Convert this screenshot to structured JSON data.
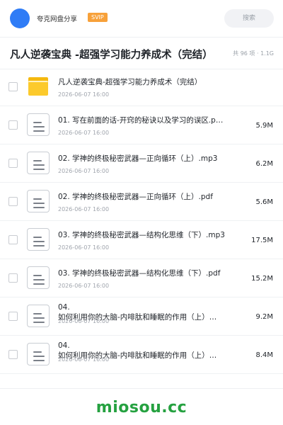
{
  "header": {
    "username": "夸克网盘分享",
    "badge": "SVIP",
    "search_placeholder": "搜索",
    "avatar_color": "#2f7cf6"
  },
  "folder": {
    "title": "凡人逆袭宝典 -超强学习能力养成术（完结）",
    "meta": "共 96 项 · 1.1G"
  },
  "files": [
    {
      "name": "凡人逆袭宝典-超强学习能力养成术（完结）",
      "date": "2026-06-07 16:00",
      "size": "",
      "type": "folder-icon"
    },
    {
      "name": "01. 写在前面的话-开窍的秘诀以及学习的误区.p…",
      "date": "2026-06-07 16:00",
      "size": "5.9M",
      "type": "document-icon"
    },
    {
      "name": "02. 学神的终极秘密武器—正向循环（上）.mp3",
      "date": "2026-06-07 16:00",
      "size": "6.2M",
      "type": "document-icon"
    },
    {
      "name": "02. 学神的终极秘密武器—正向循环（上）.pdf",
      "date": "2026-06-07 16:00",
      "size": "5.6M",
      "type": "document-icon"
    },
    {
      "name": "03. 学神的终极秘密武器—结构化思维（下）.mp3",
      "date": "2026-06-07 16:00",
      "size": "17.5M",
      "type": "document-icon"
    },
    {
      "name": "03. 学神的终极秘密武器—结构化思维（下）.pdf",
      "date": "2026-06-07 16:00",
      "size": "15.2M",
      "type": "document-icon"
    },
    {
      "name": "04.\n如何利用你的大脑-内啡肽和睡眠的作用（上）…",
      "date": "2026-06-07 16:00",
      "size": "9.2M",
      "type": "document-icon"
    },
    {
      "name": "04.\n如何利用你的大脑-内啡肽和睡眠的作用（上）…",
      "date": "2026-06-07 16:00",
      "size": "8.4M",
      "type": "document-icon"
    }
  ],
  "watermark": "miosou.cc"
}
